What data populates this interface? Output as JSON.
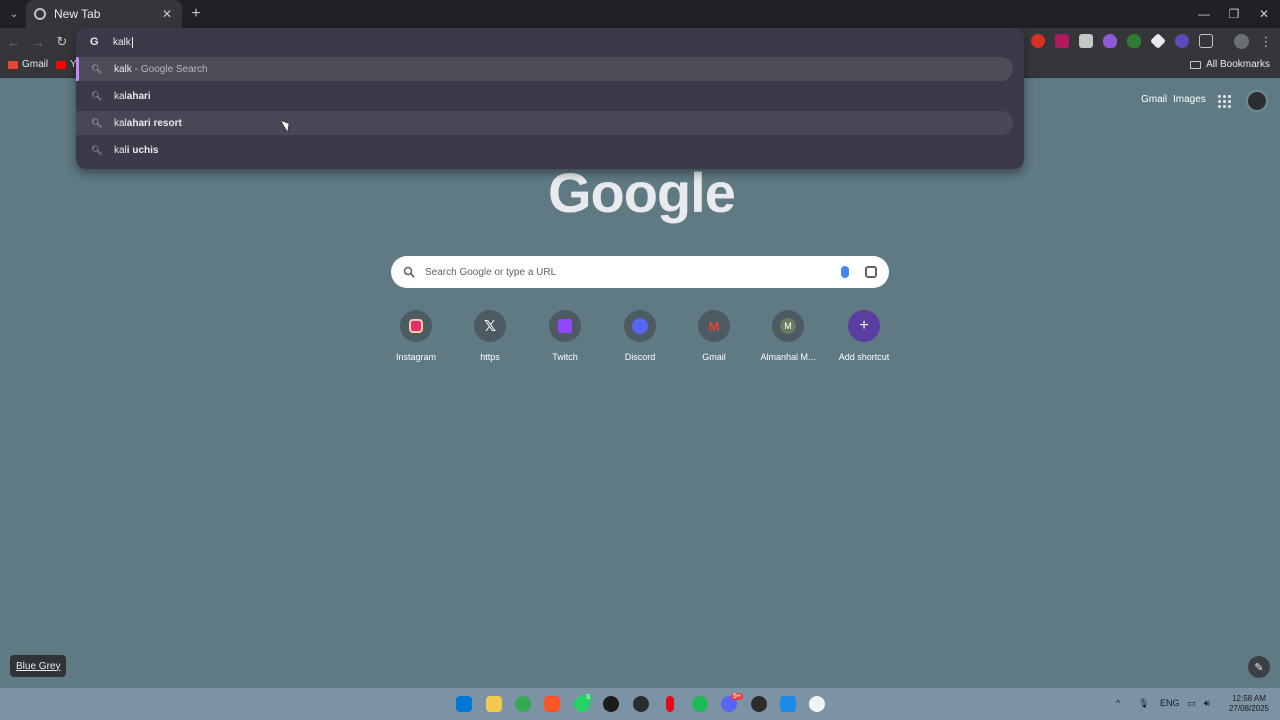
{
  "tab": {
    "title": "New Tab"
  },
  "omnibox": {
    "query": "kalk",
    "suggestions": [
      {
        "prefix": "kalk",
        "bold": "",
        "suffix": "- Google Search"
      },
      {
        "prefix": "kal",
        "bold": "ahari",
        "suffix": ""
      },
      {
        "prefix": "kal",
        "bold": "ahari resort",
        "suffix": ""
      },
      {
        "prefix": "kal",
        "bold": "i uchis",
        "suffix": ""
      }
    ]
  },
  "bookmarks": {
    "gmail": "Gmail",
    "youtube": "Yo",
    "all": "All Bookmarks"
  },
  "header": {
    "gmail": "Gmail",
    "images": "Images"
  },
  "logo": "Google",
  "search": {
    "placeholder": "Search Google or type a URL"
  },
  "shortcuts": [
    {
      "label": "Instagram",
      "icon": "instagram-icon",
      "color": "#e1306c"
    },
    {
      "label": "https",
      "icon": "x-icon",
      "color": "#000000"
    },
    {
      "label": "Twitch",
      "icon": "twitch-icon",
      "color": "#9146ff"
    },
    {
      "label": "Discord",
      "icon": "discord-icon",
      "color": "#5865f2"
    },
    {
      "label": "Gmail",
      "icon": "gmail-icon",
      "color": "#ea4335"
    },
    {
      "label": "Almanhal M...",
      "icon": "letter-m-icon",
      "color": "#6b7b5f"
    },
    {
      "label": "Add shortcut",
      "icon": "plus-icon",
      "color": "#5b3fa0"
    }
  ],
  "theme": {
    "name": "Blue Grey"
  },
  "tray": {
    "lang": "ENG",
    "time": "12:58 AM",
    "date": "27/08/2025"
  },
  "badges": {
    "whatsapp": "3",
    "discord": "9+"
  }
}
